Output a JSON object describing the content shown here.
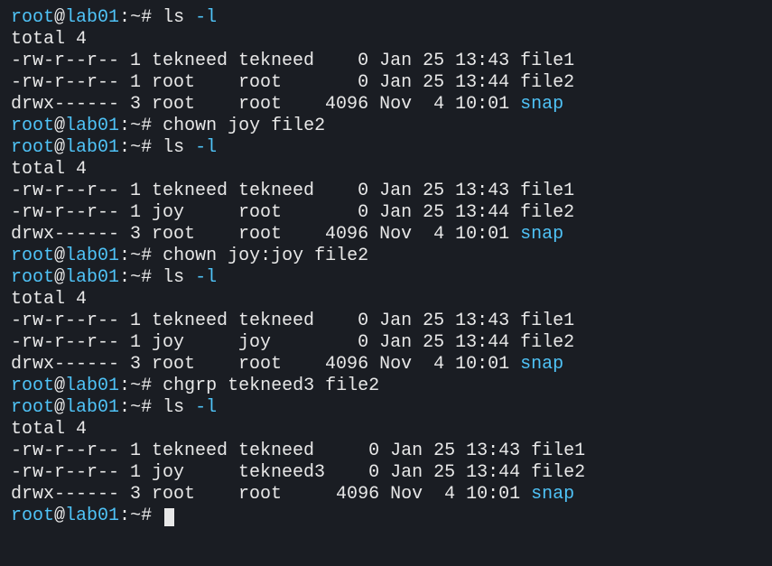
{
  "prompt": {
    "user": "root",
    "at": "@",
    "host": "lab01",
    "sep": ":",
    "path": "~",
    "symbol": "#"
  },
  "sessions": [
    {
      "cmd": "ls",
      "args": "-l",
      "total": "total 4",
      "rows": [
        {
          "perm": "-rw-r--r--",
          "links": "1",
          "owner": "tekneed",
          "group": "tekneed",
          "size": "0",
          "month": "Jan",
          "day": "25",
          "time": "13:43",
          "name": "file1",
          "isdir": false
        },
        {
          "perm": "-rw-r--r--",
          "links": "1",
          "owner": "root",
          "group": "root",
          "size": "0",
          "month": "Jan",
          "day": "25",
          "time": "13:44",
          "name": "file2",
          "isdir": false
        },
        {
          "perm": "drwx------",
          "links": "3",
          "owner": "root",
          "group": "root",
          "size": "4096",
          "month": "Nov",
          "day": "4",
          "time": "10:01",
          "name": "snap",
          "isdir": true
        }
      ]
    },
    {
      "cmd": "chown",
      "args": "joy file2"
    },
    {
      "cmd": "ls",
      "args": "-l",
      "total": "total 4",
      "rows": [
        {
          "perm": "-rw-r--r--",
          "links": "1",
          "owner": "tekneed",
          "group": "tekneed",
          "size": "0",
          "month": "Jan",
          "day": "25",
          "time": "13:43",
          "name": "file1",
          "isdir": false
        },
        {
          "perm": "-rw-r--r--",
          "links": "1",
          "owner": "joy",
          "group": "root",
          "size": "0",
          "month": "Jan",
          "day": "25",
          "time": "13:44",
          "name": "file2",
          "isdir": false
        },
        {
          "perm": "drwx------",
          "links": "3",
          "owner": "root",
          "group": "root",
          "size": "4096",
          "month": "Nov",
          "day": "4",
          "time": "10:01",
          "name": "snap",
          "isdir": true
        }
      ]
    },
    {
      "cmd": "chown",
      "args": "joy:joy file2"
    },
    {
      "cmd": "ls",
      "args": "-l",
      "total": "total 4",
      "rows": [
        {
          "perm": "-rw-r--r--",
          "links": "1",
          "owner": "tekneed",
          "group": "tekneed",
          "size": "0",
          "month": "Jan",
          "day": "25",
          "time": "13:43",
          "name": "file1",
          "isdir": false
        },
        {
          "perm": "-rw-r--r--",
          "links": "1",
          "owner": "joy",
          "group": "joy",
          "size": "0",
          "month": "Jan",
          "day": "25",
          "time": "13:44",
          "name": "file2",
          "isdir": false
        },
        {
          "perm": "drwx------",
          "links": "3",
          "owner": "root",
          "group": "root",
          "size": "4096",
          "month": "Nov",
          "day": "4",
          "time": "10:01",
          "name": "snap",
          "isdir": true,
          "textcursor": true
        }
      ]
    },
    {
      "cmd": "chgrp",
      "args": "tekneed3 file2"
    },
    {
      "cmd": "ls",
      "args": "-l",
      "total": "total 4",
      "rows": [
        {
          "perm": "-rw-r--r--",
          "links": "1",
          "owner": "tekneed",
          "group": "tekneed",
          "size": "0",
          "month": "Jan",
          "day": "25",
          "time": "13:43",
          "name": "file1",
          "isdir": false
        },
        {
          "perm": "-rw-r--r--",
          "links": "1",
          "owner": "joy",
          "group": "tekneed3",
          "size": "0",
          "month": "Jan",
          "day": "25",
          "time": "13:44",
          "name": "file2",
          "isdir": false
        },
        {
          "perm": "drwx------",
          "links": "3",
          "owner": "root",
          "group": "root",
          "size": "4096",
          "month": "Nov",
          "day": "4",
          "time": "10:01",
          "name": "snap",
          "isdir": true
        }
      ]
    }
  ]
}
